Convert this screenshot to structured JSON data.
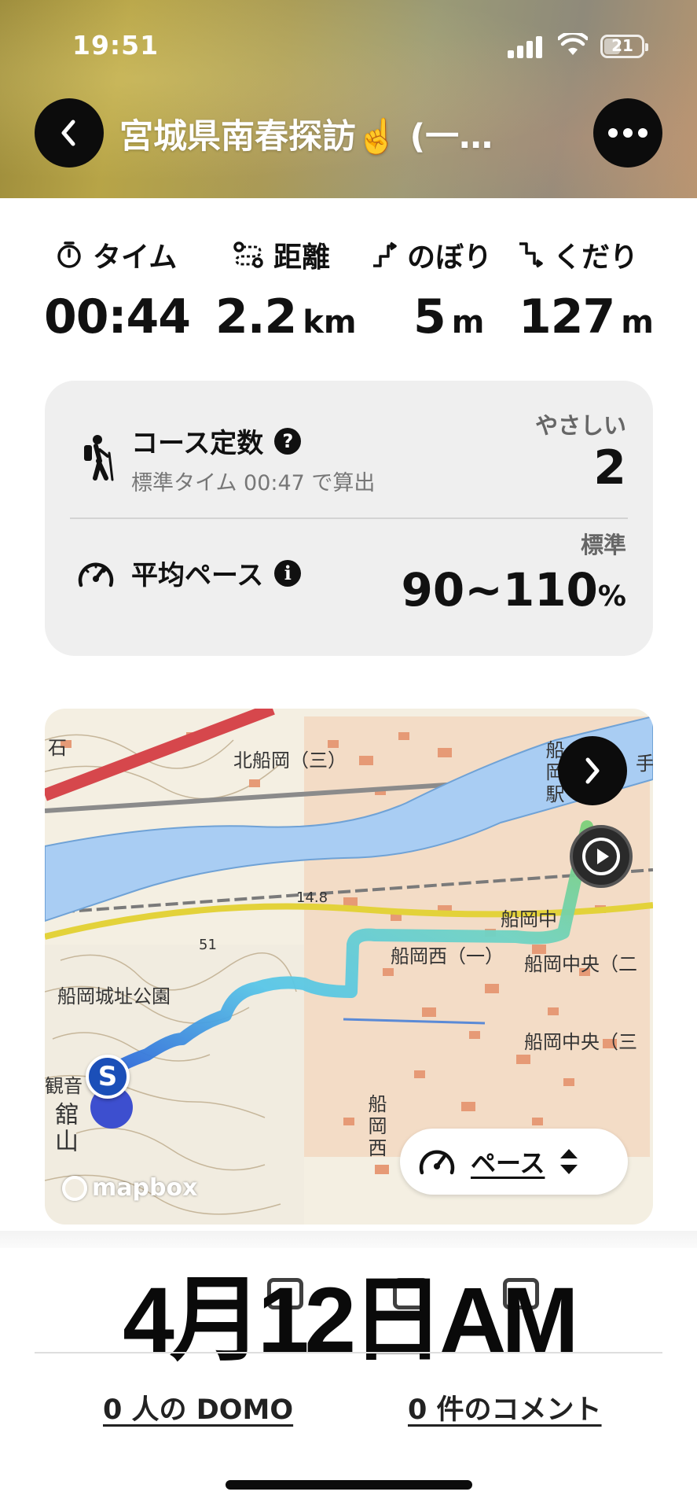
{
  "status_bar": {
    "time": "19:51",
    "battery_level": "21"
  },
  "nav": {
    "title": "宮城県南春探訪☝️ (一…"
  },
  "stats": {
    "time": {
      "label": "タイム",
      "value": "00:44"
    },
    "distance": {
      "label": "距離",
      "value": "2.2",
      "unit": "km"
    },
    "ascent": {
      "label": "のぼり",
      "value": "5",
      "unit": "m"
    },
    "descent": {
      "label": "くだり",
      "value": "127",
      "unit": "m"
    }
  },
  "course_card": {
    "constant": {
      "title": "コース定数",
      "help_icon": "?",
      "subtitle": "標準タイム 00:47 で算出",
      "difficulty_label": "やさしい",
      "value": "2"
    },
    "pace": {
      "title": "平均ペース",
      "info_icon": "i",
      "label": "標準",
      "value": "90~110",
      "unit": "%"
    }
  },
  "map": {
    "labels": {
      "kita_funaoka": "北船岡（三）",
      "funaoka_station": "船岡駅",
      "funaoka_top": "船岡中",
      "funaoka_nishi1": "船岡西（一）",
      "funaoka_chuo1": "船岡中央（二",
      "funaoka_chuo2": "船岡中央（三",
      "castle_park": "船岡城址公園",
      "kannon": "観音",
      "tateyama": "舘山",
      "funaoka_nishi_v": "船岡西",
      "fune_v": "船",
      "elev_148": "14.8",
      "elev_51": "51",
      "ishi": "石",
      "te": "手"
    },
    "start_marker": "S",
    "attribution": "mapbox",
    "pace_button": "ペース"
  },
  "date_overlay": "4月12日AM",
  "footer": {
    "domo_link": "0 人の DOMO",
    "comment_link": "0 件のコメント"
  },
  "colors": {
    "accent_dark": "#0c0c0c",
    "route_start": "#2b5fd8",
    "route_mid": "#5ec8e6",
    "route_end": "#7cd07a"
  }
}
